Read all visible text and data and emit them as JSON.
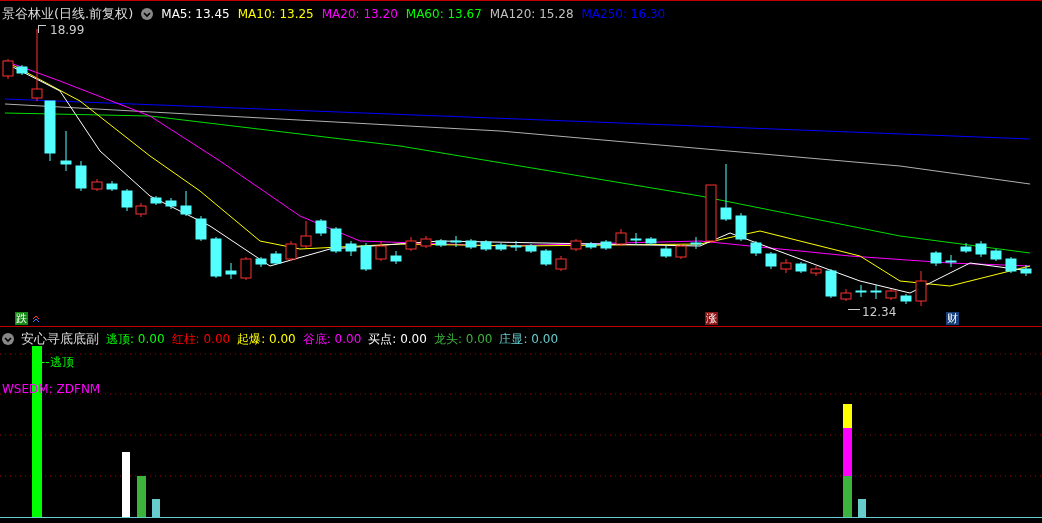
{
  "top_panel": {
    "title": "景谷林业(日线.前复权)",
    "indicators": [
      {
        "label": "MA5: 13.45",
        "color": "#ffffff"
      },
      {
        "label": "MA10: 13.25",
        "color": "#ffff00"
      },
      {
        "label": "MA20: 13.20",
        "color": "#ff00ff"
      },
      {
        "label": "MA60: 13.67",
        "color": "#00ff00"
      },
      {
        "label": "MA120: 15.28",
        "color": "#c0c0c0"
      },
      {
        "label": "MA250: 16.30",
        "color": "#0000ff"
      }
    ],
    "high_label": "18.99",
    "low_label": "12.34",
    "markers": [
      {
        "text": "跌",
        "color": "#138a13"
      },
      {
        "text": "涨",
        "color": "#8a1313"
      },
      {
        "text": "财",
        "color": "#17407a"
      }
    ]
  },
  "bottom_panel": {
    "title": "安心寻底底副",
    "indicators": [
      {
        "label": "逃顶: 0.00",
        "color": "#00ff00"
      },
      {
        "label": "红柱: 0.00",
        "color": "#ff0000"
      },
      {
        "label": "起爆: 0.00",
        "color": "#ffff00"
      },
      {
        "label": "谷底: 0.00",
        "color": "#ff00ff"
      },
      {
        "label": "买点: 0.00",
        "color": "#ffffff"
      },
      {
        "label": "龙头: 0.00",
        "color": "#3cb33c"
      },
      {
        "label": "庄显: 0.00",
        "color": "#66cccc"
      }
    ],
    "bar_label": "--逃顶",
    "note": "WSEDM: ZDFNM"
  }
}
